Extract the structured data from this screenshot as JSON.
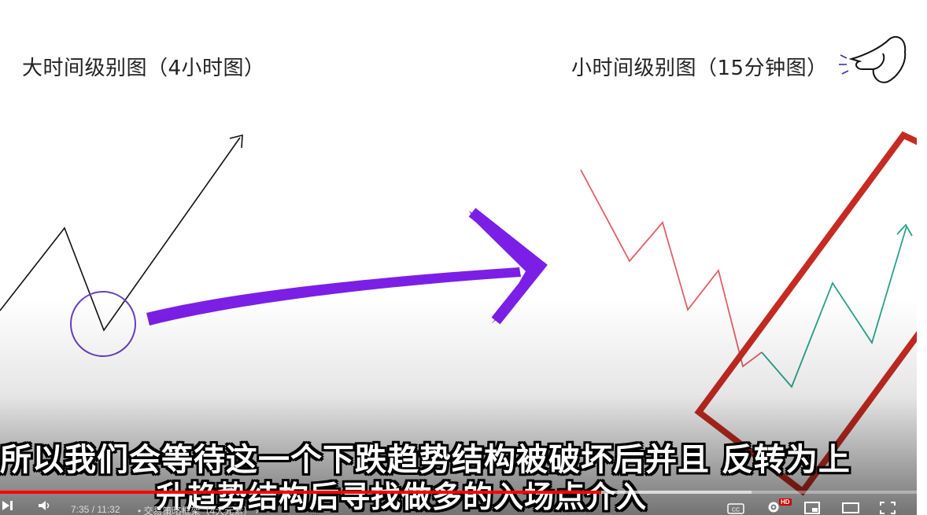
{
  "video": {
    "label_left": "大时间级别图（4小时图）",
    "label_right": "小时间级别图（15分钟图）",
    "subtitle_line1": "所以我们会等待这一个下跌趋势结构被破坏后并且 反转为上",
    "subtitle_line2": "升趋势结构后寻找做多的入场点介入"
  },
  "player": {
    "time": "7:35 / 11:32",
    "chapter": "• 交易策略框架（4大元素） ›",
    "progress_fraction": 0.656,
    "buffer_fraction": 0.82,
    "hd_badge": "HD",
    "cc_label": "CC",
    "icons": {
      "next": "next-icon",
      "volume": "volume-icon",
      "settings": "gear-icon",
      "miniplayer": "miniplayer-icon",
      "theater": "theater-icon",
      "fullscreen": "fullscreen-icon"
    }
  },
  "colors": {
    "arrow_purple": "#7b1fe6",
    "circle_purple": "#6a3fc0",
    "down_red": "#e06066",
    "up_teal": "#2aa08c",
    "box_red": "#c62b22",
    "progress_red": "#ff0000"
  }
}
